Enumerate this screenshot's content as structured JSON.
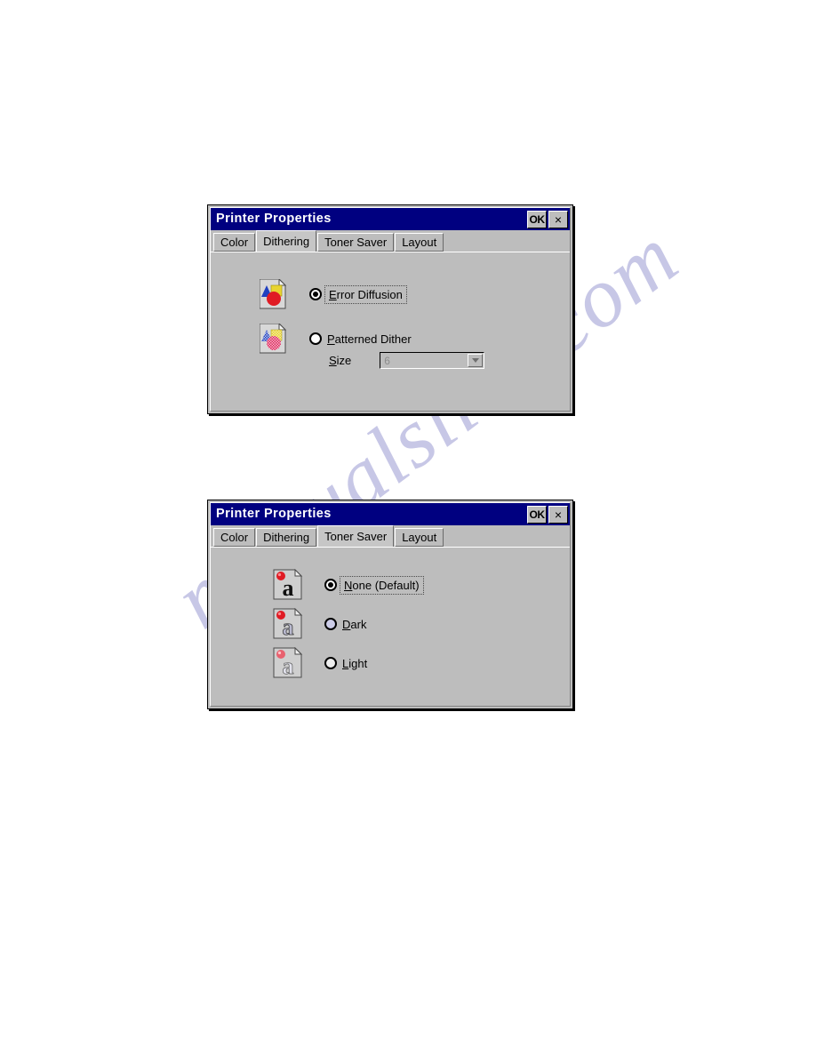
{
  "watermark": {
    "text": "manualslive.com"
  },
  "dialogs": [
    {
      "id": "dithering",
      "title": "Printer Properties",
      "titlebar": {
        "ok_label": "OK",
        "close_label": "×"
      },
      "tabs": [
        {
          "label": "Color",
          "active": false
        },
        {
          "label": "Dithering",
          "active": true
        },
        {
          "label": "Toner Saver",
          "active": false
        },
        {
          "label": "Layout",
          "active": false
        }
      ],
      "options": [
        {
          "label": "Error Diffusion",
          "accel": "E",
          "selected": true,
          "icon": "color-shapes-page-icon"
        },
        {
          "label": "Patterned Dither",
          "accel": "P",
          "selected": false,
          "icon": "dithered-shapes-page-icon"
        }
      ],
      "size_field": {
        "label": "Size",
        "accel": "S",
        "value": "6",
        "enabled": false,
        "arrow_icon": "chevron-down-icon"
      }
    },
    {
      "id": "toner",
      "title": "Printer Properties",
      "titlebar": {
        "ok_label": "OK",
        "close_label": "×"
      },
      "tabs": [
        {
          "label": "Color",
          "active": false
        },
        {
          "label": "Dithering",
          "active": false
        },
        {
          "label": "Toner Saver",
          "active": true
        },
        {
          "label": "Layout",
          "active": false
        }
      ],
      "options": [
        {
          "label": "None (Default)",
          "accel": "N",
          "selected": true,
          "icon": "letter-a-solid-page-icon"
        },
        {
          "label": "Dark",
          "accel": "D",
          "selected": false,
          "icon": "letter-a-dark-page-icon"
        },
        {
          "label": "Light",
          "accel": "L",
          "selected": false,
          "icon": "letter-a-light-page-icon"
        }
      ]
    }
  ],
  "colors": {
    "titlebar": "#000080",
    "dialog_face": "#bdbdbd",
    "watermark": "#c7c7e6",
    "accent_red": "#e01b24",
    "accent_blue": "#2040c0",
    "accent_yellow": "#e8d430"
  }
}
